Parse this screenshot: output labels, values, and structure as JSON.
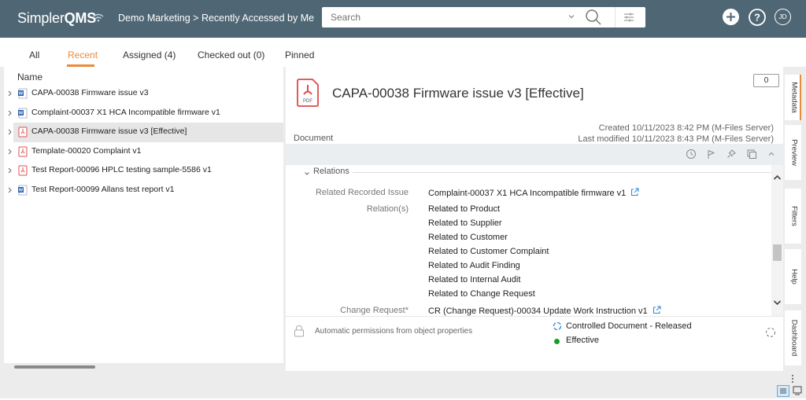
{
  "app": {
    "logo_prefix": "Simpler",
    "logo_suffix": "QMS",
    "breadcrumb": "Demo Marketing > Recently Accessed by Me",
    "user_initials": "JD"
  },
  "search": {
    "placeholder": "Search",
    "value": ""
  },
  "tabs": [
    {
      "label": "All",
      "active": false
    },
    {
      "label": "Recent",
      "active": true
    },
    {
      "label": "Assigned (4)",
      "active": false
    },
    {
      "label": "Checked out (0)",
      "active": false
    },
    {
      "label": "Pinned",
      "active": false
    }
  ],
  "list": {
    "header": "Name",
    "items": [
      {
        "label": "CAPA-00038 Firmware issue v3",
        "icon": "word-doc-icon",
        "selected": false
      },
      {
        "label": "Complaint-00037 X1 HCA Incompatible firmware v1",
        "icon": "word-doc-icon",
        "selected": false
      },
      {
        "label": "CAPA-00038 Firmware issue v3 [Effective]",
        "icon": "pdf-icon",
        "selected": true
      },
      {
        "label": "Template-00020 Complaint v1",
        "icon": "pdf-icon",
        "selected": false
      },
      {
        "label": "Test Report-00096 HPLC testing sample-5586 v1",
        "icon": "pdf-icon",
        "selected": false
      },
      {
        "label": "Test Report-00099 Allans test report v1",
        "icon": "word-doc-icon",
        "selected": false
      }
    ]
  },
  "detail": {
    "title": "CAPA-00038 Firmware issue v3 [Effective]",
    "file_type": "PDF",
    "comment_count": "0",
    "object_type": "Document",
    "created": "Created 10/11/2023 8:42 PM (M-Files Server)",
    "modified": "Last modified 10/11/2023 8:43 PM (M-Files Server)",
    "section": "Relations",
    "properties": {
      "related_issue_label": "Related Recorded Issue",
      "related_issue_value": "Complaint-00037 X1 HCA Incompatible firmware v1",
      "relations_label": "Relation(s)",
      "relations": [
        "Related to Product",
        "Related to Supplier",
        "Related to Customer",
        "Related to Customer Complaint",
        "Related to Audit Finding",
        "Related to Internal Audit",
        "Related to Change Request"
      ],
      "change_request_label": "Change Request*",
      "change_request_value": "CR (Change Request)-00034 Update Work Instruction v1"
    },
    "permissions": "Automatic permissions from object properties",
    "workflow": "Controlled Document - Released",
    "state": "Effective",
    "state_color": "#1a9b2a"
  },
  "side_tabs": [
    {
      "label": "Metadata",
      "active": true
    },
    {
      "label": "Preview",
      "active": false
    },
    {
      "label": "Filters",
      "active": false
    },
    {
      "label": "Help",
      "active": false
    },
    {
      "label": "Dashboard",
      "active": false
    }
  ],
  "colors": {
    "topbar": "#4f6775",
    "accent": "#e98b3a",
    "link": "#2b88d8"
  }
}
